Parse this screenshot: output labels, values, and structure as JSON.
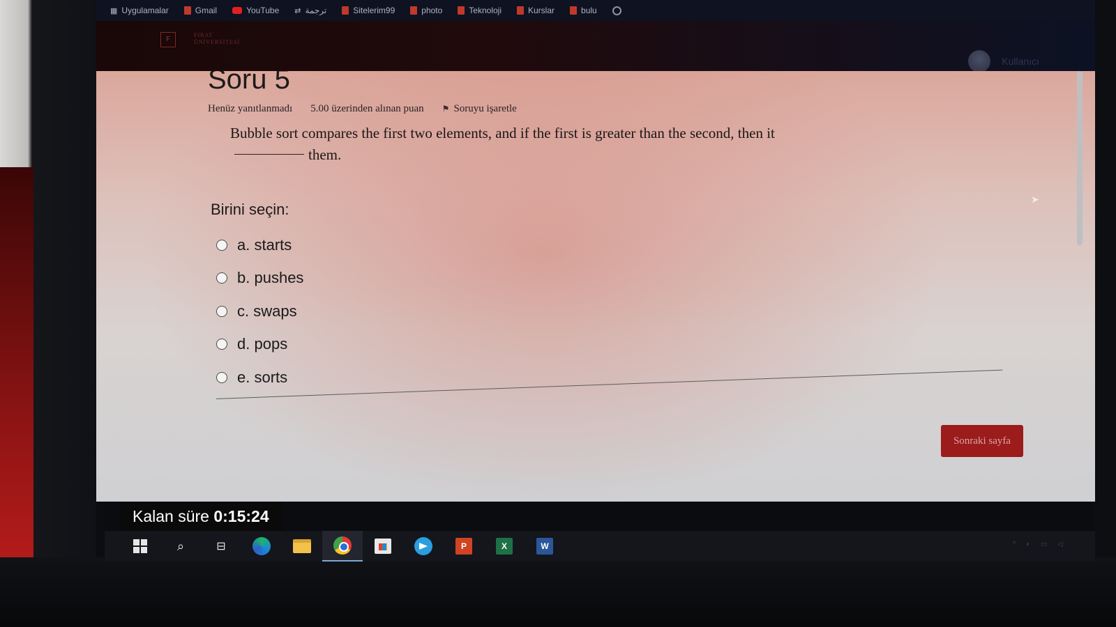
{
  "bookmarks": [
    {
      "label": "Uygulamalar",
      "icon": "apps-icon"
    },
    {
      "label": "Gmail",
      "icon": "gmail-icon"
    },
    {
      "label": "YouTube",
      "icon": "youtube-icon"
    },
    {
      "label": "ترجمة",
      "icon": "translate-icon"
    },
    {
      "label": "Sitelerim99",
      "icon": "bookmark-icon"
    },
    {
      "label": "photo",
      "icon": "bookmark-icon"
    },
    {
      "label": "Teknoloji",
      "icon": "bookmark-icon"
    },
    {
      "label": "Kurslar",
      "icon": "bookmark-icon"
    },
    {
      "label": "bulu",
      "icon": "bookmark-icon"
    }
  ],
  "header": {
    "logo_mark": "F",
    "logo_line1": "FIRAT",
    "logo_line2": "ÜNİVERSİTESİ",
    "user_name": "Kullanıcı"
  },
  "question": {
    "title": "Soru 5",
    "status": "Henüz yanıtlanmadı",
    "points": "5.00 üzerinden alınan puan",
    "flag_label": "Soruyu işaretle",
    "text_before": "Bubble sort compares the first two elements, and if the first is greater than the second, then it",
    "text_after": "them.",
    "choose_label": "Birini seçin:",
    "answers": [
      {
        "letter": "a.",
        "text": "starts"
      },
      {
        "letter": "b.",
        "text": "pushes"
      },
      {
        "letter": "c.",
        "text": "swaps"
      },
      {
        "letter": "d.",
        "text": "pops"
      },
      {
        "letter": "e.",
        "text": "sorts"
      }
    ],
    "next_button": "Sonraki sayfa"
  },
  "timer": {
    "label": "Kalan süre",
    "value": "0:15:24"
  },
  "taskbar": {
    "ppt_letter": "P",
    "xls_letter": "X",
    "doc_letter": "W"
  },
  "colors": {
    "accent": "#9c1b1b",
    "timer_bg": "#0a0a0a"
  }
}
